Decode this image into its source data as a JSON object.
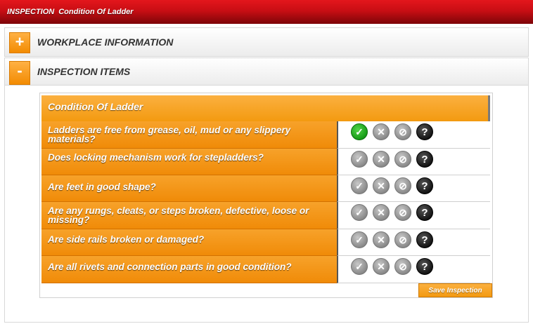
{
  "header": {
    "prefix": "INSPECTION",
    "title": "Condition Of Ladder"
  },
  "sections": [
    {
      "toggle": "+",
      "label": "WORKPLACE INFORMATION"
    },
    {
      "toggle": "-",
      "label": "INSPECTION ITEMS"
    }
  ],
  "checklist": {
    "title": "Condition Of Ladder",
    "items": [
      {
        "question": "Ladders are free from grease, oil, mud or any slippery materials?",
        "selected": "pass"
      },
      {
        "question": "Does locking mechanism work for stepladders?",
        "selected": "none"
      },
      {
        "question": "Are feet in good shape?",
        "selected": "none"
      },
      {
        "question": "Are any rungs, cleats, or steps broken, defective, loose or missing?",
        "selected": "none"
      },
      {
        "question": "Are side rails broken or damaged?",
        "selected": "none"
      },
      {
        "question": "Are all rivets and connection parts in good condition?",
        "selected": "none"
      }
    ],
    "icon_glyphs": {
      "pass": "✓",
      "fail": "✕",
      "na": "⊘",
      "unknown": "?"
    }
  },
  "buttons": {
    "save": "Save Inspection"
  },
  "colors": {
    "accent": "#f39a10",
    "header": "#c80e14",
    "selected_pass": "#179c17"
  }
}
